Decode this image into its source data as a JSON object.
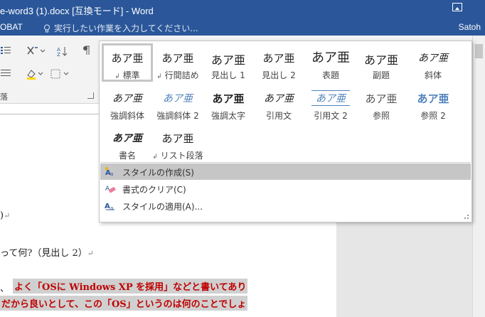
{
  "window": {
    "title": "e-word3 (1).docx [互換モード] - Word",
    "ribbon_options_icon": "ribbon-display-options-icon"
  },
  "tabs": {
    "acrobat": "OBAT",
    "tell_me_placeholder": "実行したい作業を入力してください...",
    "user": "Satoh"
  },
  "ribbon": {
    "paragraph_group_label": "落"
  },
  "style_gallery": {
    "tiles": [
      {
        "sample": "あア亜",
        "name": "標準",
        "selected": true,
        "para_mark": true
      },
      {
        "sample": "あア亜",
        "name": "行間詰め",
        "para_mark": true
      },
      {
        "sample": "あア亜",
        "name": "見出し 1"
      },
      {
        "sample": "あア亜",
        "name": "見出し 2"
      },
      {
        "sample": "あア亜",
        "name": "表題"
      },
      {
        "sample": "あア亜",
        "name": "副題"
      },
      {
        "sample": "あア亜",
        "name": "斜体"
      },
      {
        "sample": "あア亜",
        "name": "強調斜体"
      },
      {
        "sample": "あア亜",
        "name": "強調斜体 2"
      },
      {
        "sample": "あア亜",
        "name": "強調太字"
      },
      {
        "sample": "あア亜",
        "name": "引用文"
      },
      {
        "sample": "あア亜",
        "name": "引用文 2"
      },
      {
        "sample": "あア亜",
        "name": "参照"
      },
      {
        "sample": "あア亜",
        "name": "参照 2"
      },
      {
        "sample": "あア亜",
        "name": "書名"
      },
      {
        "sample": "あア亜",
        "name": "リスト段落",
        "para_mark": true
      }
    ],
    "menu": [
      {
        "label": "スタイルの作成(S)",
        "icon": "create-style-icon",
        "highlighted": true
      },
      {
        "label": "書式のクリア(C)",
        "icon": "clear-formatting-icon"
      },
      {
        "label": "スタイルの適用(A)...",
        "icon": "apply-styles-icon"
      }
    ]
  },
  "document": {
    "line1": ")",
    "line2": "って何?（見出し 2）",
    "line3_prefix": "、",
    "line3_red": "よく「OSに Windows XP を採用」などと書いてあり",
    "line4_red": "だから良いとして、この「OS」というのは何のことでしょ",
    "paragraph_mark": "↵",
    "colors": {
      "red_text": "#c00000",
      "highlight": "#d0d0d0"
    }
  },
  "colors": {
    "title_bar": "#2b579a",
    "accent_blue": "#4f81bd"
  }
}
